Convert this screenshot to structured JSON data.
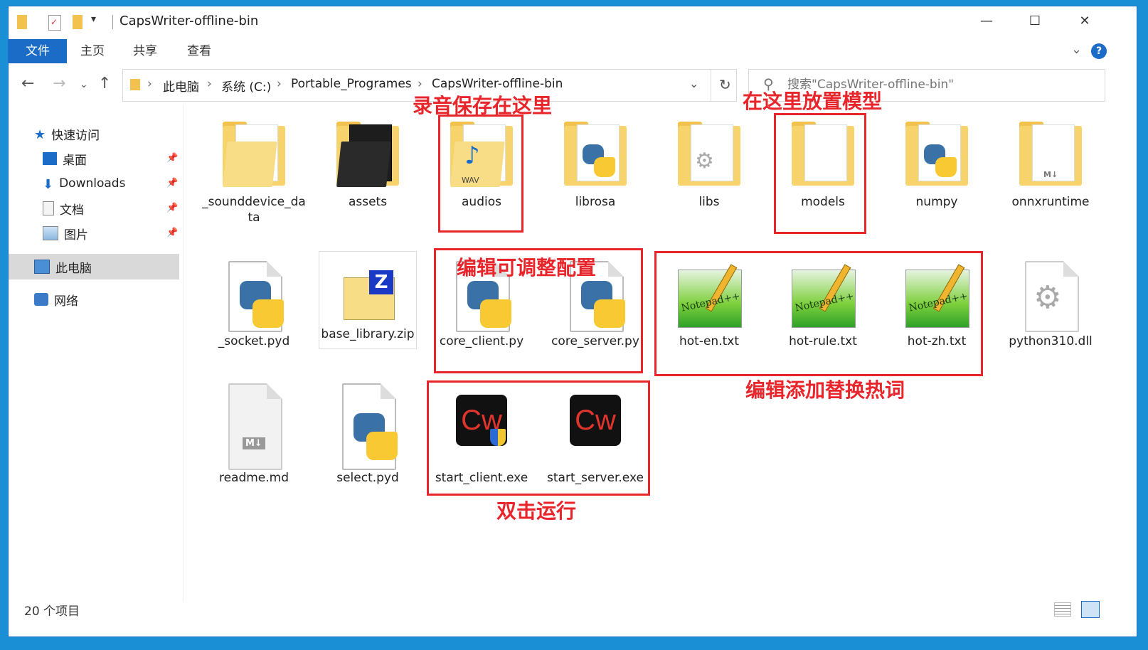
{
  "window": {
    "title": "CapsWriter-offline-bin"
  },
  "ribbon": {
    "tabs": [
      "文件",
      "主页",
      "共享",
      "查看"
    ]
  },
  "address": {
    "crumbs": [
      "此电脑",
      "系统 (C:)",
      "Portable_Programes",
      "CapsWriter-offline-bin"
    ]
  },
  "search": {
    "placeholder": "搜索\"CapsWriter-offline-bin\""
  },
  "nav": {
    "quick_access": "快速访问",
    "items": [
      "桌面",
      "Downloads",
      "文档",
      "图片"
    ],
    "this_pc": "此电脑",
    "network": "网络"
  },
  "files": [
    {
      "name": "_sounddevice_data",
      "icon": "folder-doc-icon"
    },
    {
      "name": "assets",
      "icon": "folder-dark-icon"
    },
    {
      "name": "audios",
      "icon": "folder-wav-icon"
    },
    {
      "name": "librosa",
      "icon": "folder-python-icon"
    },
    {
      "name": "libs",
      "icon": "folder-gear-icon"
    },
    {
      "name": "models",
      "icon": "folder-empty-icon"
    },
    {
      "name": "numpy",
      "icon": "folder-python-icon"
    },
    {
      "name": "onnxruntime",
      "icon": "folder-md-icon"
    },
    {
      "name": "_socket.pyd",
      "icon": "python-file-icon"
    },
    {
      "name": "base_library.zip",
      "icon": "zip-icon"
    },
    {
      "name": "core_client.py",
      "icon": "python-file-icon"
    },
    {
      "name": "core_server.py",
      "icon": "python-file-icon"
    },
    {
      "name": "hot-en.txt",
      "icon": "notepadpp-icon"
    },
    {
      "name": "hot-rule.txt",
      "icon": "notepadpp-icon"
    },
    {
      "name": "hot-zh.txt",
      "icon": "notepadpp-icon"
    },
    {
      "name": "python310.dll",
      "icon": "dll-icon"
    },
    {
      "name": "readme.md",
      "icon": "markdown-file-icon"
    },
    {
      "name": "select.pyd",
      "icon": "python-file-icon"
    },
    {
      "name": "start_client.exe",
      "icon": "capswriter-client-icon"
    },
    {
      "name": "start_server.exe",
      "icon": "capswriter-server-icon"
    }
  ],
  "annotations": {
    "audios": "录音保存在这里",
    "models": "在这里放置模型",
    "config": "编辑可调整配置",
    "hotwords": "编辑添加替换热词",
    "run": "双击运行"
  },
  "status": {
    "count": "20 个项目"
  },
  "colors": {
    "accent": "#1a6cc6",
    "annotation": "#e8252b"
  }
}
